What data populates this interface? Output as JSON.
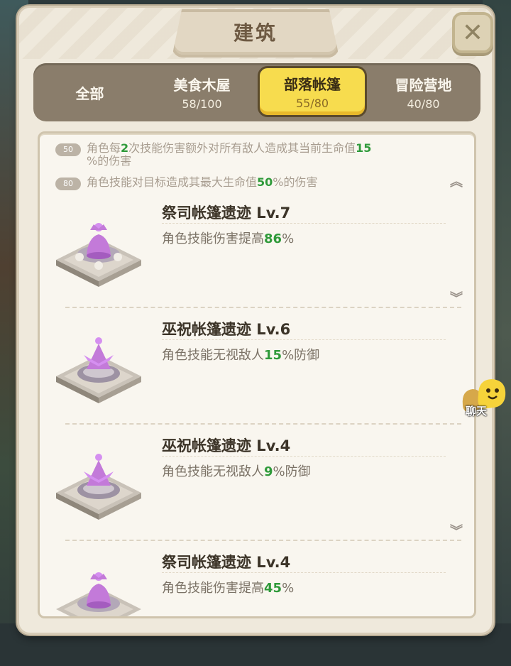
{
  "header": {
    "title": "建筑",
    "close_icon": "close-x-icon"
  },
  "tabs": [
    {
      "label": "全部",
      "count": ""
    },
    {
      "label": "美食木屋",
      "count": "58/100"
    },
    {
      "label": "部落帐篷",
      "count": "55/80",
      "active": true
    },
    {
      "label": "冒险营地",
      "count": "40/80"
    }
  ],
  "bonuses": [
    {
      "badge": "50",
      "pre": "角色每",
      "v1": "2",
      "mid": "次技能伤害额外对所有敌人造成其当前生命值",
      "v2": "15",
      "post": "%的伤害"
    },
    {
      "badge": "80",
      "pre": "角色技能对目标造成其最大生命值",
      "v1": "50",
      "post": "%的伤害"
    }
  ],
  "buildings": [
    {
      "name": "祭司帐篷遗迹  Lv.7",
      "effect_pre": "角色技能伤害提高",
      "effect_val": "86",
      "effect_post": "%",
      "icon": "priest-tent-ruin-icon"
    },
    {
      "name": "巫祝帐篷遗迹  Lv.6",
      "effect_pre": "角色技能无视敌人",
      "effect_val": "15",
      "effect_post": "%防御",
      "icon": "shaman-tent-ruin-icon"
    },
    {
      "name": "巫祝帐篷遗迹  Lv.4",
      "effect_pre": "角色技能无视敌人",
      "effect_val": "9",
      "effect_post": "%防御",
      "icon": "shaman-tent-ruin-icon"
    },
    {
      "name": "祭司帐篷遗迹  Lv.4",
      "effect_pre": "角色技能伤害提高",
      "effect_val": "45",
      "effect_post": "%",
      "icon": "priest-tent-ruin-icon"
    }
  ],
  "chat": {
    "label": "聊天"
  },
  "colors": {
    "accent_tab": "#f7dc4e",
    "value_green": "#2f9a3a",
    "panel": "#efe9dc"
  }
}
